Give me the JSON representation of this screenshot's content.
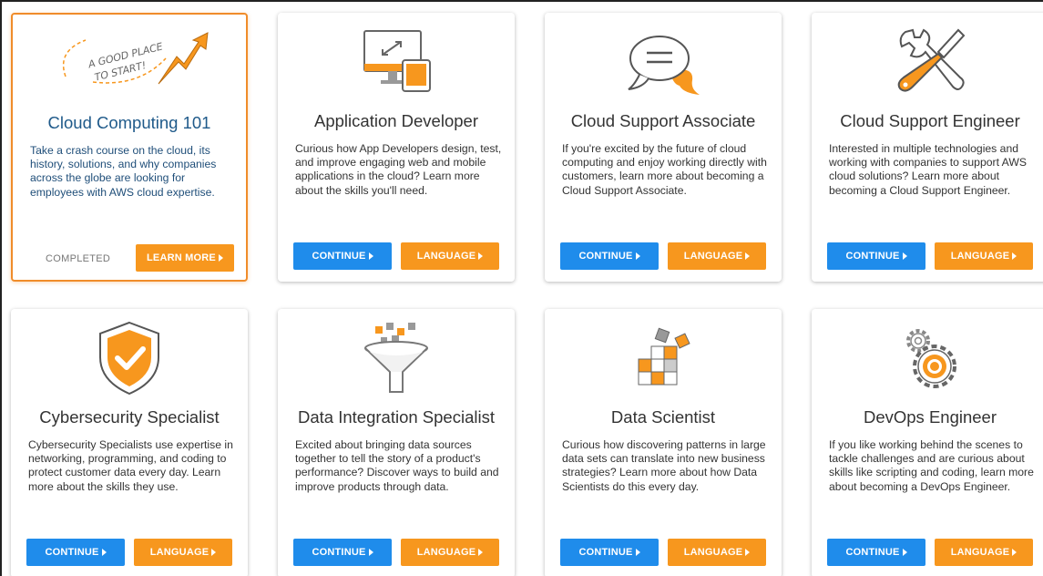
{
  "cards": [
    {
      "title": "Cloud Computing 101",
      "description": "Take a crash course on the cloud, its history, solutions, and why companies across the globe are looking for employees with AWS cloud expertise.",
      "icon": "good-place-to-start-icon",
      "status": "COMPLETED",
      "primary_button": "LEARN MORE",
      "banner_text": "A GOOD PLACE TO START!"
    },
    {
      "title": "Application Developer",
      "description": "Curious how App Developers design, test, and improve engaging web and mobile applications in the cloud? Learn more about the skills you'll need.",
      "icon": "devices-icon",
      "primary_button": "CONTINUE",
      "secondary_button": "LANGUAGE"
    },
    {
      "title": "Cloud Support Associate",
      "description": "If you're excited by the future of cloud computing and enjoy working directly with customers, learn more about becoming a Cloud Support Associate.",
      "icon": "chat-bubble-icon",
      "primary_button": "CONTINUE",
      "secondary_button": "LANGUAGE"
    },
    {
      "title": "Cloud Support Engineer",
      "description": "Interested in multiple technologies and working with companies to support AWS cloud solutions? Learn more about becoming a Cloud Support Engineer.",
      "icon": "wrench-screwdriver-icon",
      "primary_button": "CONTINUE",
      "secondary_button": "LANGUAGE"
    },
    {
      "title": "Cybersecurity Specialist",
      "description": "Cybersecurity Specialists use expertise in networking, programming, and coding to protect customer data every day. Learn more about the skills they use.",
      "icon": "shield-check-icon",
      "primary_button": "CONTINUE",
      "secondary_button": "LANGUAGE"
    },
    {
      "title": "Data Integration Specialist",
      "description": "Excited about bringing data sources together to tell the story of a product's performance? Discover ways to build and improve products through data.",
      "icon": "funnel-icon",
      "primary_button": "CONTINUE",
      "secondary_button": "LANGUAGE"
    },
    {
      "title": "Data Scientist",
      "description": "Curious how discovering patterns in large data sets can translate into new business strategies? Learn more about how Data Scientists do this every day.",
      "icon": "data-cubes-icon",
      "primary_button": "CONTINUE",
      "secondary_button": "LANGUAGE"
    },
    {
      "title": "DevOps Engineer",
      "description": "If you like working behind the scenes to tackle challenges and are curious about skills like scripting and coding, learn more about becoming a DevOps Engineer.",
      "icon": "gears-icon",
      "primary_button": "CONTINUE",
      "secondary_button": "LANGUAGE"
    }
  ],
  "colors": {
    "accent_orange": "#f7971e",
    "button_blue": "#1f8ceb",
    "highlight_border": "#f08c2a",
    "title_blue": "#1f5a8a"
  }
}
